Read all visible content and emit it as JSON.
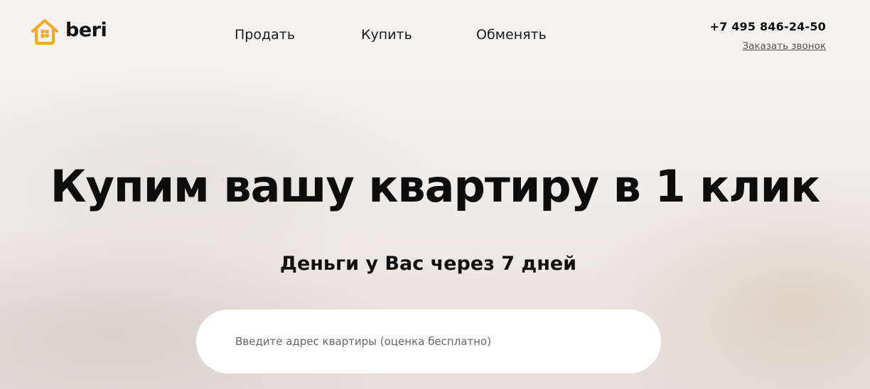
{
  "brand": {
    "name": "beri",
    "accent_color": "#f5a623",
    "logo_icon": "house-icon"
  },
  "nav": {
    "items": [
      {
        "label": "Продать"
      },
      {
        "label": "Купить"
      },
      {
        "label": "Обменять"
      }
    ]
  },
  "contact": {
    "phone": "+7 495 846-24-50",
    "callback_label": "Заказать звонок"
  },
  "hero": {
    "title": "Купим вашу квартиру в 1 клик",
    "subtitle": "Деньги у Вас через 7 дней"
  },
  "search": {
    "placeholder": "Введите адрес квартиры (оценка бесплатно)",
    "value": ""
  }
}
